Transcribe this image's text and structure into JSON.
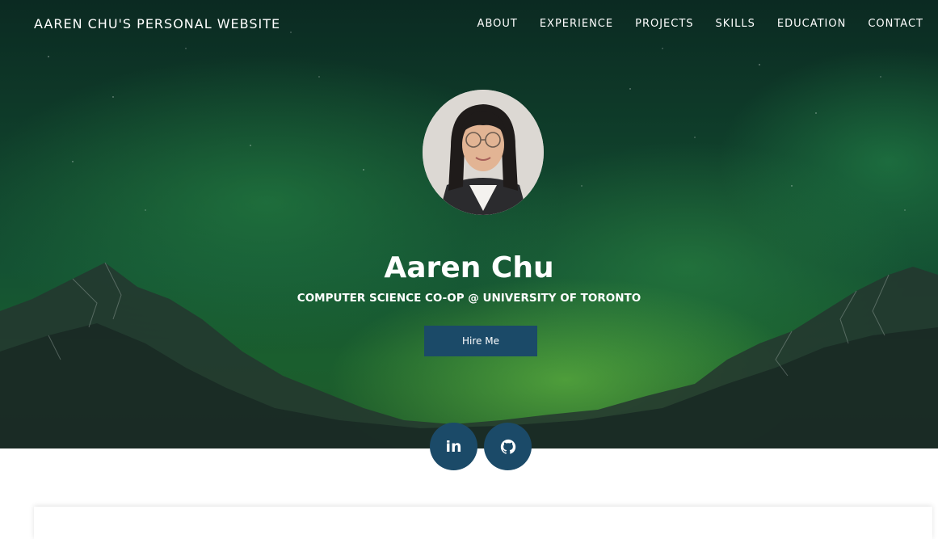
{
  "nav": {
    "brand": "AAREN CHU'S PERSONAL WEBSITE",
    "links": [
      "ABOUT",
      "EXPERIENCE",
      "PROJECTS",
      "SKILLS",
      "EDUCATION",
      "CONTACT"
    ]
  },
  "hero": {
    "name": "Aaren Chu",
    "subtitle": "COMPUTER SCIENCE CO-OP @ UNIVERSITY OF TORONTO",
    "cta_label": "Hire Me"
  },
  "social": {
    "linkedin_icon_text": "in",
    "icons": [
      "linkedin-icon",
      "github-icon"
    ]
  },
  "colors": {
    "accent": "#1b4a68",
    "hero_dark": "#0f3d2a",
    "aurora": "#2e8b3e"
  }
}
